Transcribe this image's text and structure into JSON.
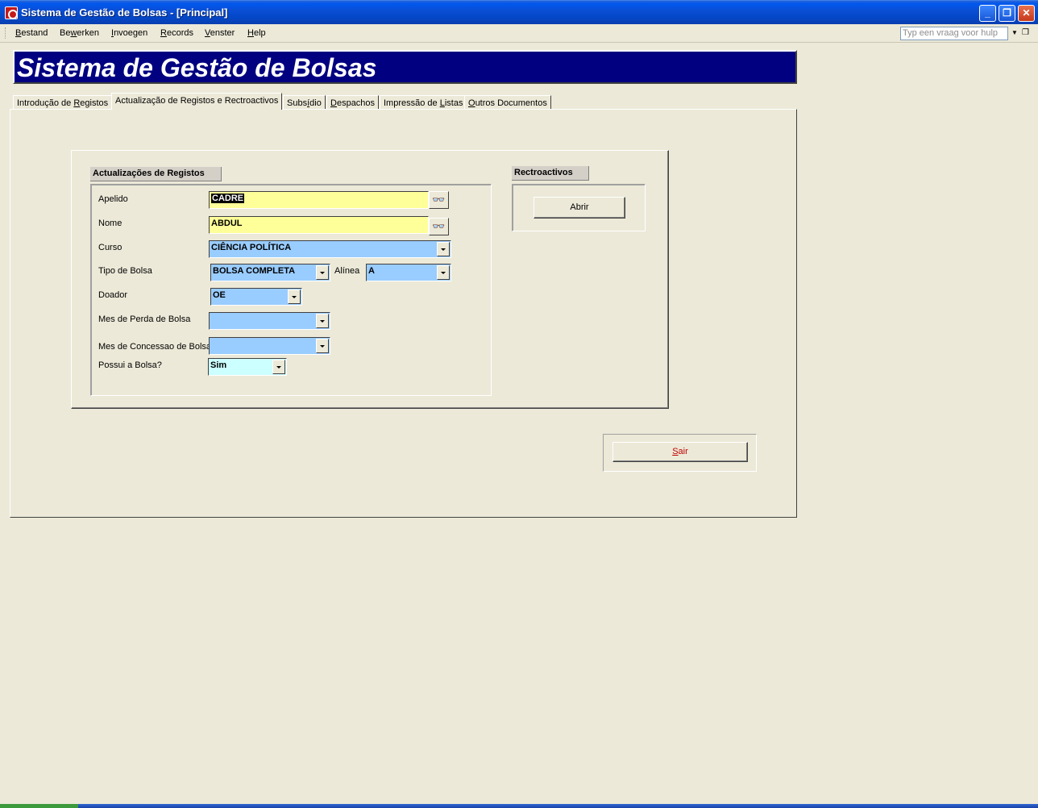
{
  "window": {
    "title": "Sistema de Gestão de Bolsas - [Principal]"
  },
  "menu": {
    "items": [
      {
        "prefix": "",
        "accel": "B",
        "rest": "estand"
      },
      {
        "prefix": "Be",
        "accel": "w",
        "rest": "erken"
      },
      {
        "prefix": "",
        "accel": "I",
        "rest": "nvoegen"
      },
      {
        "prefix": "",
        "accel": "R",
        "rest": "ecords"
      },
      {
        "prefix": "",
        "accel": "V",
        "rest": "enster"
      },
      {
        "prefix": "",
        "accel": "H",
        "rest": "elp"
      }
    ],
    "help_placeholder": "Typ een vraag voor hulp"
  },
  "banner": {
    "title": "Sistema de Gestão de Bolsas"
  },
  "tabs": [
    {
      "prefix": "Introdução de ",
      "accel": "R",
      "rest": "egistos"
    },
    {
      "prefix": "Actualização de Registos e  Rectroactivos",
      "accel": "",
      "rest": ""
    },
    {
      "prefix": "Subs",
      "accel": "í",
      "rest": "dio"
    },
    {
      "prefix": "",
      "accel": "D",
      "rest": "espachos"
    },
    {
      "prefix": "Impressão de ",
      "accel": "L",
      "rest": "istas"
    },
    {
      "prefix": "",
      "accel": "O",
      "rest": "utros Documentos"
    }
  ],
  "active_tab": "Actualização de Registos e  Rectroactivos",
  "registos": {
    "section_title": "Actualizações de Registos",
    "apelido_label": "Apelido",
    "apelido_value": "CADRE",
    "nome_label": "Nome",
    "nome_value": "ABDUL",
    "curso_label": "Curso",
    "curso_value": "CIÊNCIA POLÍTICA",
    "tipo_label": "Tipo de Bolsa",
    "tipo_value": "BOLSA COMPLETA",
    "alinea_label": "Alínea",
    "alinea_value": "A",
    "doador_label": "Doador",
    "doador_value": "OE",
    "perda_label": "Mes de Perda de Bolsa",
    "perda_value": "",
    "concessao_label": "Mes de Concessao de Bolsa",
    "concessao_value": "",
    "possui_label": "Possui a Bolsa?",
    "possui_value": "Sim"
  },
  "rectroactivos": {
    "section_title": "Rectroactivos",
    "abrir_label": "Abrir"
  },
  "sair": {
    "accel": "S",
    "rest": "air"
  },
  "colors": {
    "banner_bg": "#000080",
    "yellow_field": "#ffff99",
    "blue_field": "#99ccff",
    "cyan_field": "#ccffff",
    "window_bg": "#ECE9D8"
  }
}
